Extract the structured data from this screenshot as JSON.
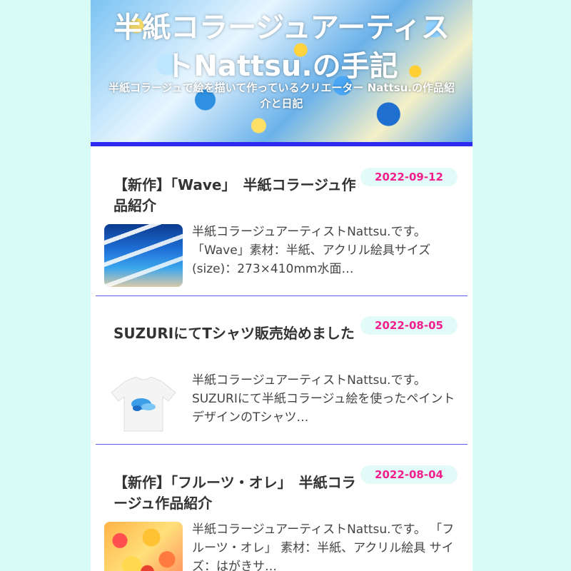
{
  "site": {
    "title": "半紙コラージュアーティストNattsu.の手記",
    "subtitle": "半紙コラージュで絵を描いて作っているクリエーター Nattsu.の作品紹介と日記"
  },
  "posts": [
    {
      "date": "2022-09-12",
      "title": "【新作】「Wave」　半紙コラージュ作品紹介",
      "excerpt": "半紙コラージュアーティストNattsu.です。 「Wave」素材：半紙、アクリル絵具サイズ(size)：273×410mm水面…",
      "thumb_icon": "wave-artwork-thumbnail"
    },
    {
      "date": "2022-08-05",
      "title": "SUZURIにてTシャツ販売始めました",
      "excerpt": "半紙コラージュアーティストNattsu.です。 SUZURIにて半紙コラージュ絵を使ったペイントデザインのTシャツ…",
      "thumb_icon": "tshirt-thumbnail"
    },
    {
      "date": "2022-08-04",
      "title": "【新作】「フルーツ・オレ」　半紙コラージュ作品紹介",
      "excerpt": "半紙コラージュアーティストNattsu.です。 「フルーツ・オレ」 素材：半紙、アクリル絵具 サイズ：はがきサ…",
      "thumb_icon": "fruit-artwork-thumbnail"
    }
  ],
  "colors": {
    "page_bg": "#d9fbf5",
    "accent_bar": "#2e2bf0",
    "date_text": "#f21f8d",
    "date_bg": "#e3fbf8",
    "divider": "#5c58f0"
  }
}
